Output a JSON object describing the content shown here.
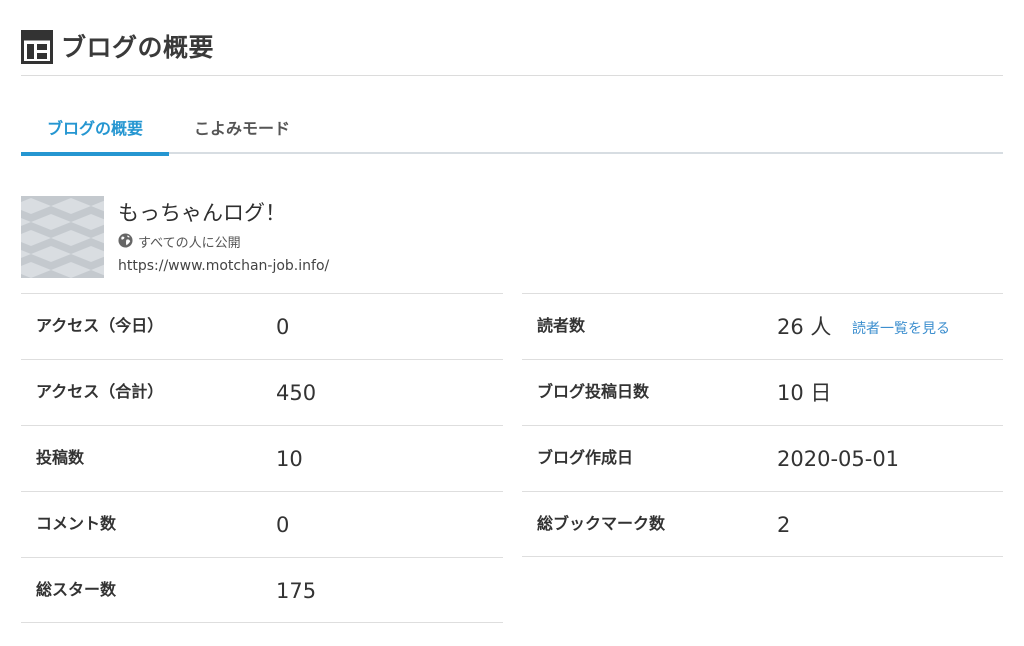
{
  "header": {
    "title": "ブログの概要"
  },
  "tabs": [
    {
      "label": "ブログの概要"
    },
    {
      "label": "こよみモード"
    }
  ],
  "blog": {
    "name": "もっちゃんログ！",
    "visibility": "すべての人に公開",
    "url": "https://www.motchan-job.info/"
  },
  "stats_left": [
    {
      "label": "アクセス（今日）",
      "value": "0"
    },
    {
      "label": "アクセス（合計）",
      "value": "450"
    },
    {
      "label": "投稿数",
      "value": "10"
    },
    {
      "label": "コメント数",
      "value": "0"
    },
    {
      "label": "総スター数",
      "value": "175"
    }
  ],
  "stats_right": [
    {
      "label": "読者数",
      "value": "26 人",
      "link": "読者一覧を見る"
    },
    {
      "label": "ブログ投稿日数",
      "value": "10 日"
    },
    {
      "label": "ブログ作成日",
      "value": "2020-05-01"
    },
    {
      "label": "総ブックマーク数",
      "value": "2"
    }
  ],
  "colors": {
    "accent": "#2596d1",
    "link": "#3d8fcf",
    "divider": "#dedede"
  },
  "icons": {
    "header": "dashboard-layout-icon",
    "visibility": "globe-icon"
  }
}
